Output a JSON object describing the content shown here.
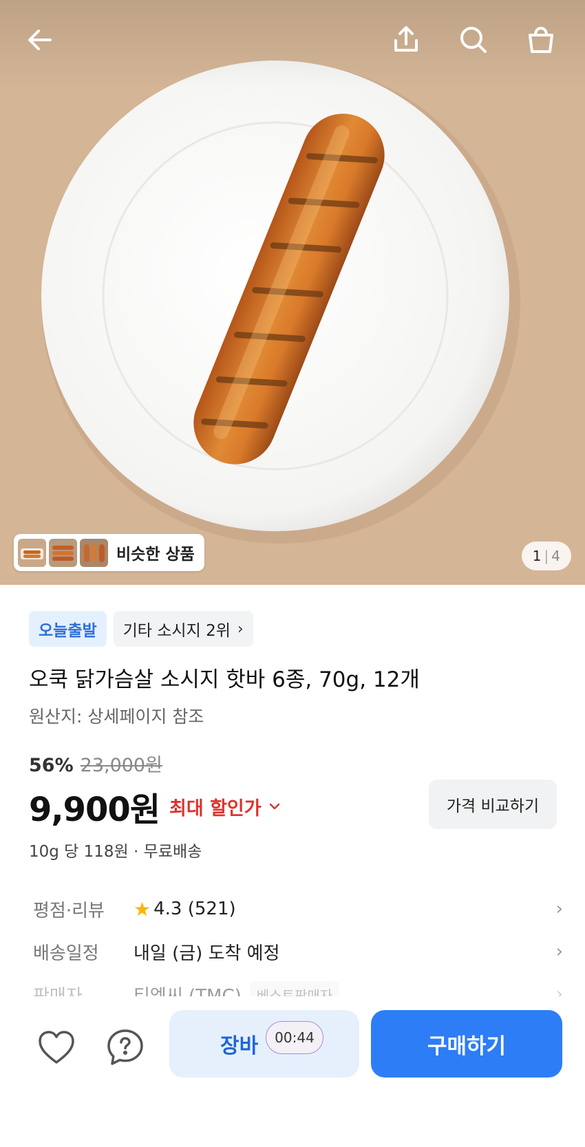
{
  "image_counter": {
    "current": "1",
    "total": "4"
  },
  "similar": {
    "label": "비슷한 상품"
  },
  "tags": {
    "today": "오늘출발",
    "rank": "기타 소시지 2위",
    "rank_chevron": "›"
  },
  "product": {
    "title": "오쿡 닭가슴살 소시지 핫바 6종, 70g, 12개",
    "origin": "원산지: 상세페이지 참조"
  },
  "pricing": {
    "discount_pct": "56%",
    "original_price": "23,000원",
    "price": "9,900원",
    "max_discount_label": "최대 할인가",
    "compare_label": "가격 비교하기",
    "unit_info": "10g 당 118원 · 무료배송"
  },
  "details": {
    "rating_label": "평점·리뷰",
    "rating_value": "4.3 (521)",
    "delivery_label": "배송일정",
    "delivery_value": "내일 (금) 도착 예정",
    "seller_label": "판매자",
    "seller_value": "티엠씨 (TMC)",
    "seller_badge": "베스트판매자"
  },
  "actions": {
    "cart_label": "장바",
    "timer": "00:44",
    "buy_label": "구매하기"
  },
  "colors": {
    "accent_blue": "#2d7df6",
    "discount_red": "#e0312b",
    "star_yellow": "#ffb400"
  }
}
